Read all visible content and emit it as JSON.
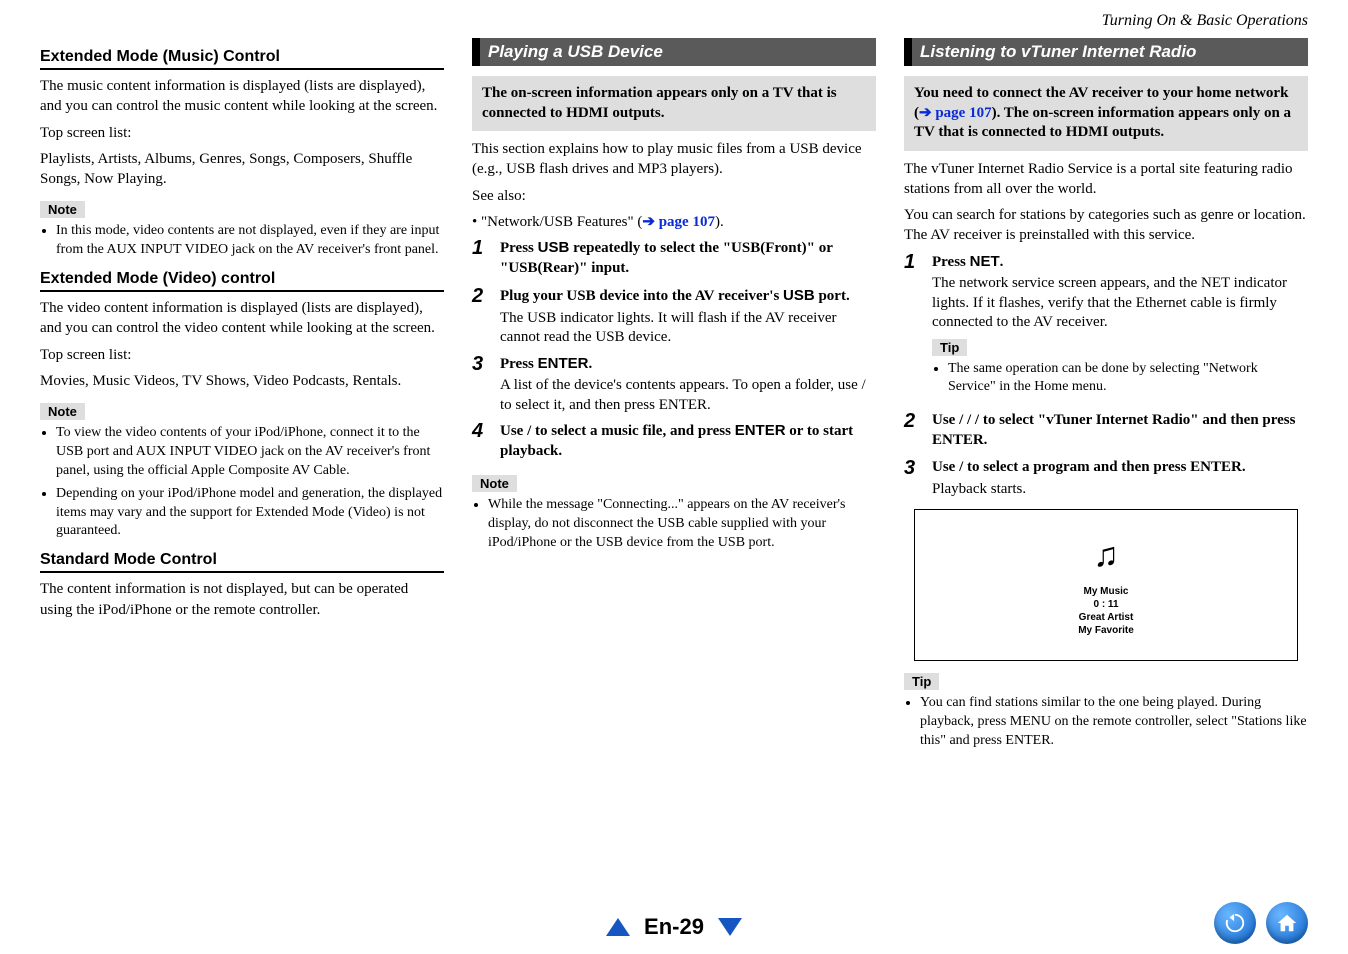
{
  "header": {
    "section_path": "Turning On & Basic Operations"
  },
  "col1": {
    "h_music": "Extended Mode (Music) Control",
    "music_p1": "The music content information is displayed (lists are displayed), and you can control the music content while looking at the screen.",
    "music_p2a": "Top screen list:",
    "music_p2b": "Playlists, Artists, Albums, Genres, Songs, Composers, Shuffle Songs, Now Playing.",
    "note_label": "Note",
    "music_note": "In this mode, video contents are not displayed, even if they are input from the AUX INPUT VIDEO jack on the AV receiver's front panel.",
    "h_video": "Extended Mode (Video) control",
    "video_p1": "The video content information is displayed (lists are displayed), and you can control the video content while looking at the screen.",
    "video_p2a": "Top screen list:",
    "video_p2b": "Movies, Music Videos, TV Shows, Video Podcasts, Rentals.",
    "video_note1": "To view the video contents of your iPod/iPhone, connect it to the USB port and AUX INPUT VIDEO jack on the AV receiver's front panel, using the official Apple Composite AV Cable.",
    "video_note2": "Depending on your iPod/iPhone model and generation, the displayed items may vary and the support for Extended Mode (Video) is not guaranteed.",
    "h_std": "Standard Mode Control",
    "std_p": "The content information is not displayed, but can be operated using the iPod/iPhone or the remote controller."
  },
  "col2": {
    "bar": "Playing a USB Device",
    "info": "The on-screen information appears only on a TV that is connected to HDMI outputs.",
    "intro_a": "This section explains how to play music files from a USB device (e.g., USB flash drives and MP3 players).",
    "intro_b": "See also:",
    "intro_link_pre": "• \"Network/USB Features\" (",
    "intro_link": "page 107",
    "intro_link_post": ").",
    "steps": [
      {
        "n": "1",
        "instr_pre": "Press ",
        "instr_mid": "USB",
        "instr_post": " repeatedly to select the \"USB(Front)\" or \"USB(Rear)\" input."
      },
      {
        "n": "2",
        "instr_pre": "Plug your USB device into the AV receiver's ",
        "instr_mid": "USB",
        "instr_post": " port.",
        "desc": "The USB indicator lights. It will flash if the AV receiver cannot read the USB device."
      },
      {
        "n": "3",
        "instr_pre": "Press ",
        "instr_mid": "ENTER",
        "instr_post": ".",
        "desc": "A list of the device's contents appears. To open a folder, use   /   to select it, and then press ENTER."
      },
      {
        "n": "4",
        "instr_pre": "Use   /   to select a music file, and press ",
        "instr_mid": "ENTER",
        "instr_post": " or   to start playback."
      }
    ],
    "note_label": "Note",
    "note": "While the message \"Connecting...\" appears on the AV receiver's display, do not disconnect the USB cable supplied with your iPod/iPhone or the USB device from the USB port."
  },
  "col3": {
    "bar": "Listening to vTuner Internet Radio",
    "info_pre": "You need to connect the AV receiver to your home network (",
    "info_link": "page 107",
    "info_post": "). The on-screen information appears only on a TV that is connected to HDMI outputs.",
    "p1": "The vTuner Internet Radio Service is a portal site featuring radio stations from all over the world.",
    "p2": "You can search for stations by categories such as genre or location. The AV receiver is preinstalled with this service.",
    "steps": [
      {
        "n": "1",
        "instr_pre": "Press ",
        "instr_mid": "NET",
        "instr_post": ".",
        "desc": "The network service screen appears, and the NET indicator lights. If it flashes, verify that the Ethernet cable is firmly connected to the AV receiver.",
        "tip_label": "Tip",
        "tip": "The same operation can be done by selecting \"Network Service\" in the Home menu."
      },
      {
        "n": "2",
        "instr": "Use   /  /  /   to select \"vTuner Internet Radio\" and then press ENTER."
      },
      {
        "n": "3",
        "instr": "Use   /   to select a program and then press ENTER.",
        "desc": "Playback starts."
      }
    ],
    "screen": {
      "l1": "My Music",
      "l2": "0 : 11",
      "l3": "Great Artist",
      "l4": "My Favorite"
    },
    "tip_label": "Tip",
    "tip": "You can find stations similar to the one being played. During playback, press MENU on the remote controller, select \"Stations like this\" and press ENTER."
  },
  "footer": {
    "page": "En-29"
  }
}
